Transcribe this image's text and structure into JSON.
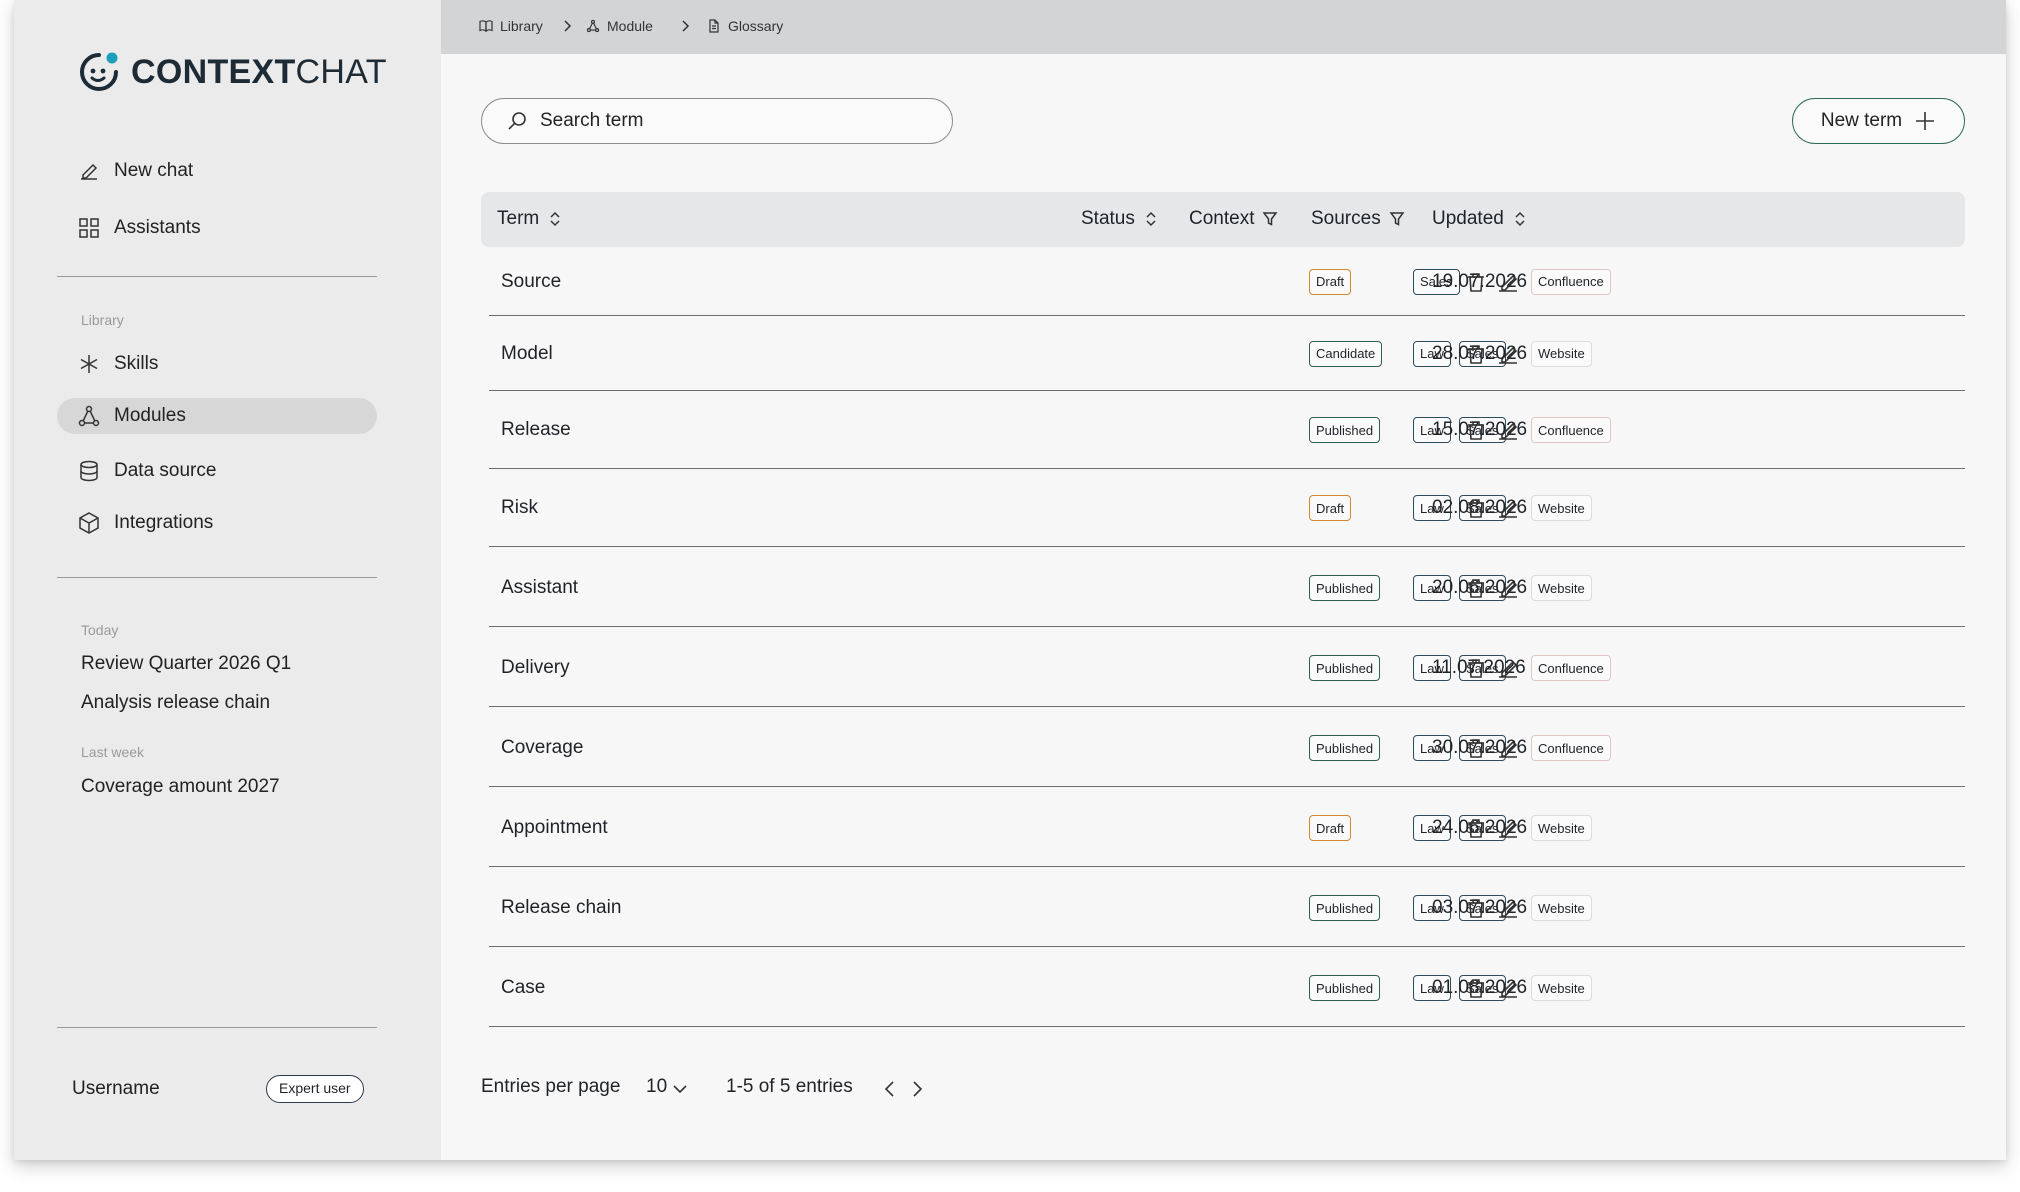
{
  "app": {
    "logo_bold": "CONTEXT",
    "logo_light": "CHAT",
    "accent": "#1d2b36",
    "logo_dot_color": "#1aa0b8"
  },
  "sidebar": {
    "top_items": [
      {
        "label": "New chat",
        "icon": "pencil-icon"
      },
      {
        "label": "Assistants",
        "icon": "grid-icon"
      }
    ],
    "library_label": "Library",
    "library_items": [
      {
        "label": "Skills",
        "icon": "asterisk-icon",
        "active": false
      },
      {
        "label": "Modules",
        "icon": "modules-icon",
        "active": true
      },
      {
        "label": "Data source",
        "icon": "database-icon",
        "active": false
      },
      {
        "label": "Integrations",
        "icon": "cube-icon",
        "active": false
      }
    ],
    "history": [
      {
        "group": "Today",
        "items": [
          "Review Quarter 2026 Q1",
          "Analysis release chain"
        ]
      },
      {
        "group": "Last week",
        "items": [
          "Coverage amount 2027"
        ]
      }
    ],
    "username": "Username",
    "user_badge": "Expert user"
  },
  "breadcrumb": [
    {
      "label": "Library",
      "icon": "book-icon"
    },
    {
      "label": "Module",
      "icon": "modules-icon"
    },
    {
      "label": "Glossary",
      "icon": "document-icon"
    }
  ],
  "toolbar": {
    "search_placeholder": "Search term",
    "new_button": "New term"
  },
  "table": {
    "columns": {
      "term": "Term",
      "status": "Status",
      "context": "Context",
      "sources": "Sources",
      "updated": "Updated"
    },
    "rows": [
      {
        "term": "Source",
        "status": "Draft",
        "context": [
          "Sales"
        ],
        "source": "Confluence",
        "updated": "19.07.2026"
      },
      {
        "term": "Model",
        "status": "Candidate",
        "context": [
          "Law",
          "Sales"
        ],
        "source": "Website",
        "updated": "28.07.2026"
      },
      {
        "term": "Release",
        "status": "Published",
        "context": [
          "Law",
          "Sales"
        ],
        "source": "Confluence",
        "updated": "15.07.2026"
      },
      {
        "term": "Risk",
        "status": "Draft",
        "context": [
          "Law",
          "Sales"
        ],
        "source": "Website",
        "updated": "02.08.2026"
      },
      {
        "term": "Assistant",
        "status": "Published",
        "context": [
          "Law",
          "Sales"
        ],
        "source": "Website",
        "updated": "20.06.2026"
      },
      {
        "term": "Delivery",
        "status": "Published",
        "context": [
          "Law",
          "Sales"
        ],
        "source": "Confluence",
        "updated": "11.07.2026"
      },
      {
        "term": "Coverage",
        "status": "Published",
        "context": [
          "Law",
          "Sales"
        ],
        "source": "Confluence",
        "updated": "30.07.2026"
      },
      {
        "term": "Appointment",
        "status": "Draft",
        "context": [
          "Law",
          "Sales"
        ],
        "source": "Website",
        "updated": "24.06.2026"
      },
      {
        "term": "Release chain",
        "status": "Published",
        "context": [
          "Law",
          "Sales"
        ],
        "source": "Website",
        "updated": "03.07.2026"
      },
      {
        "term": "Case",
        "status": "Published",
        "context": [
          "Law",
          "Sales"
        ],
        "source": "Website",
        "updated": "01.08.2026"
      }
    ]
  },
  "pagination": {
    "per_page_label": "Entries per page",
    "per_page_value": "10",
    "range": "1-5 of 5 entries"
  }
}
